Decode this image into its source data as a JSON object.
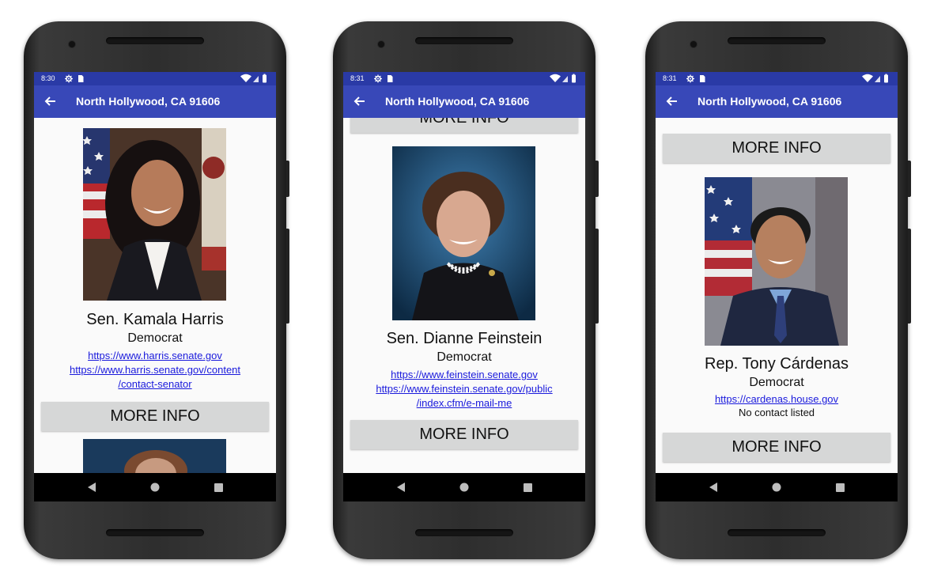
{
  "phones": [
    {
      "status_time": "8:30",
      "appbar_title": "North Hollywood, CA 91606",
      "rep_name": "Sen. Kamala Harris",
      "party": "Democrat",
      "website": "https://www.harris.senate.gov",
      "contact_line1": "https://www.harris.senate.gov/content",
      "contact_line2": "/contact-senator",
      "more_info": "MORE INFO"
    },
    {
      "status_time": "8:31",
      "appbar_title": "North Hollywood, CA 91606",
      "prev_more_info": "MORE INFO",
      "rep_name": "Sen. Dianne Feinstein",
      "party": "Democrat",
      "website": "https://www.feinstein.senate.gov",
      "contact_line1": "https://www.feinstein.senate.gov/public",
      "contact_line2": "/index.cfm/e-mail-me",
      "more_info": "MORE INFO"
    },
    {
      "status_time": "8:31",
      "appbar_title": "North Hollywood, CA 91606",
      "prev_more_info": "MORE INFO",
      "rep_name": "Rep. Tony Cárdenas",
      "party": "Democrat",
      "website": "https://cardenas.house.gov",
      "no_contact": "No contact listed",
      "more_info": "MORE INFO"
    }
  ],
  "icons": {
    "status": [
      "gear-icon",
      "sd-card-icon",
      "wifi-icon",
      "signal-icon",
      "battery-icon"
    ],
    "appbar": "back-arrow-icon",
    "navbar": [
      "back-triangle-icon",
      "home-circle-icon",
      "recents-square-icon"
    ]
  },
  "colors": {
    "status_bar": "#2a3aa6",
    "app_bar": "#3848b8",
    "link": "#1a1adc",
    "button": "#d6d7d7"
  }
}
